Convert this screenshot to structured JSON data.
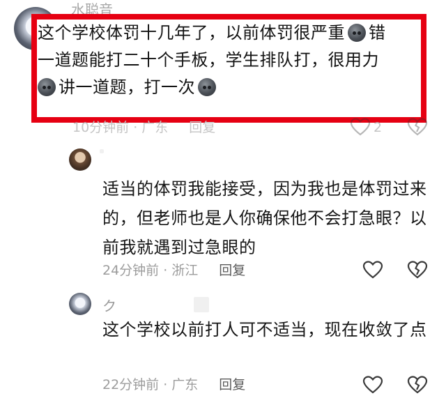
{
  "comments": [
    {
      "name": "水聪音",
      "lines": [
        {
          "parts": [
            "这个学校体罚十几年了，以前体罚很严重",
            "emoji",
            "错"
          ]
        },
        {
          "parts": [
            "一道题能打二十个手板，学生排队打，很用力"
          ]
        },
        {
          "parts": [
            "emoji",
            "讲一道题，打一次",
            "emoji"
          ]
        }
      ],
      "time": "10分钟前 · 广东",
      "reply": "回复",
      "like_count": "2"
    },
    {
      "text": "适当的体罚我能接受，因为我也是体罚过来的，但老师也是人你确保他不会打急眼？以前我就遇到过急眼的",
      "time": "24分钟前 · 浙江",
      "reply": "回复"
    },
    {
      "name": "ク",
      "text": "这个学校以前打人可不适当，现在收敛了点",
      "time": "22分钟前 · 广东",
      "reply": "回复"
    }
  ],
  "icons": {
    "like": "heart-outline-icon",
    "dislike": "broken-heart-icon",
    "emoji": "sweat-face-emoji-icon"
  }
}
